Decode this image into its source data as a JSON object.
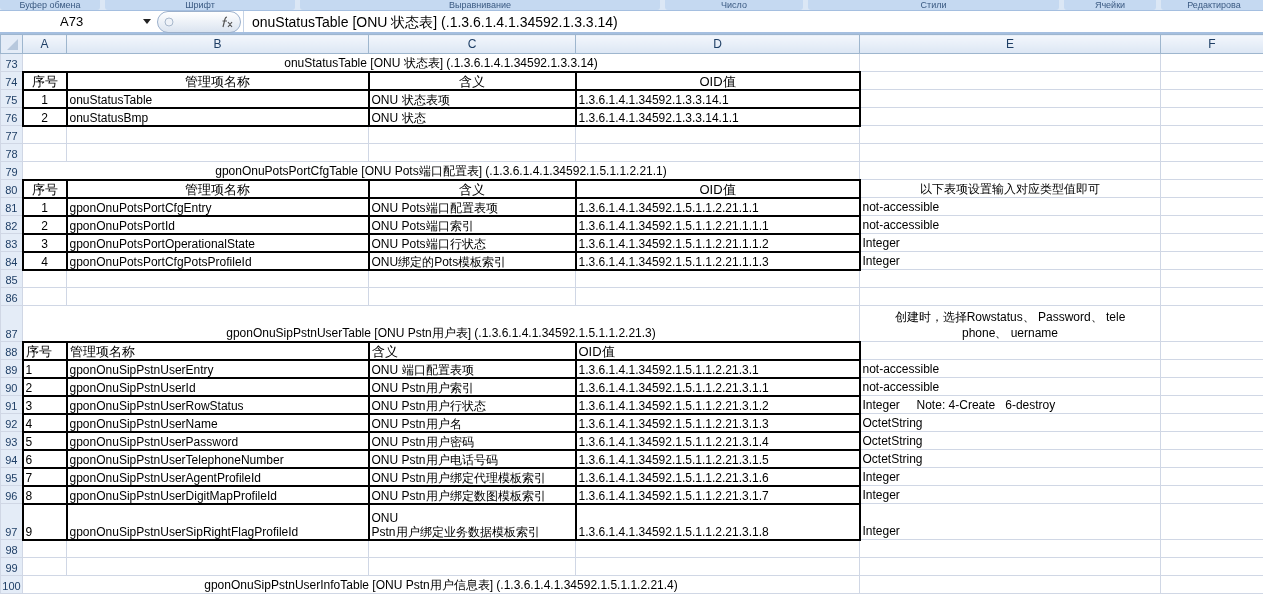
{
  "ribbon_groups": [
    "Буфер обмена",
    "Шрифт",
    "Выравнивание",
    "Число",
    "Стили",
    "Ячейки",
    "Редактирова"
  ],
  "name_box": "A73",
  "formula": "onuStatusTable [ONU 状态表] (.1.3.6.1.4.1.34592.1.3.3.14)",
  "columns": [
    "A",
    "B",
    "C",
    "D",
    "E",
    "F"
  ],
  "rows": [
    {
      "number": "73",
      "kind": "title",
      "tall": false,
      "text": "onuStatusTable [ONU 状态表] (.1.3.6.1.4.1.34592.1.3.3.14)"
    },
    {
      "number": "74",
      "kind": "header",
      "centered": true,
      "cells": [
        "序号",
        "管理项名称",
        "含义",
        "OID值"
      ]
    },
    {
      "number": "75",
      "kind": "data",
      "centered": true,
      "cells": [
        "1",
        "onuStatusTable",
        "ONU 状态表项",
        "1.3.6.1.4.1.34592.1.3.3.14.1"
      ]
    },
    {
      "number": "76",
      "kind": "data",
      "centered": true,
      "cells": [
        "2",
        "onuStatusBmp",
        "ONU 状态",
        "1.3.6.1.4.1.34592.1.3.3.14.1.1"
      ]
    },
    {
      "number": "77",
      "kind": "empty"
    },
    {
      "number": "78",
      "kind": "empty"
    },
    {
      "number": "79",
      "kind": "title",
      "tall": false,
      "text": "gponOnuPotsPortCfgTable [ONU Pots端口配置表] (.1.3.6.1.4.1.34592.1.5.1.1.2.21.1)"
    },
    {
      "number": "80",
      "kind": "header",
      "centered": true,
      "cells": [
        "序号",
        "管理项名称",
        "含义",
        "OID值"
      ],
      "note": "以下表项设置输入对应类型值即可"
    },
    {
      "number": "81",
      "kind": "data",
      "centered": true,
      "cells": [
        "1",
        "gponOnuPotsPortCfgEntry",
        "ONU Pots端口配置表项",
        "1.3.6.1.4.1.34592.1.5.1.1.2.21.1.1"
      ],
      "note": "not-accessible"
    },
    {
      "number": "82",
      "kind": "data",
      "centered": true,
      "cells": [
        "2",
        "gponOnuPotsPortId",
        "ONU Pots端口索引",
        "1.3.6.1.4.1.34592.1.5.1.1.2.21.1.1.1"
      ],
      "note": "not-accessible"
    },
    {
      "number": "83",
      "kind": "data",
      "centered": true,
      "cells": [
        "3",
        "gponOnuPotsPortOperationalState",
        "ONU Pots端口行状态",
        "1.3.6.1.4.1.34592.1.5.1.1.2.21.1.1.2"
      ],
      "note": "Integer"
    },
    {
      "number": "84",
      "kind": "data",
      "centered": true,
      "cells": [
        "4",
        "gponOnuPotsPortCfgPotsProfileId",
        "ONU绑定的Pots模板索引",
        "1.3.6.1.4.1.34592.1.5.1.1.2.21.1.1.3"
      ],
      "note": "Integer"
    },
    {
      "number": "85",
      "kind": "empty"
    },
    {
      "number": "86",
      "kind": "empty"
    },
    {
      "number": "87",
      "kind": "title",
      "tall": true,
      "text": "gponOnuSipPstnUserTable [ONU Pstn用户表] (.1.3.6.1.4.1.34592.1.5.1.1.2.21.3)",
      "note": "创建时，选择Rowstatus、 Password、 tele\nphone、 uername"
    },
    {
      "number": "88",
      "kind": "header",
      "centered": false,
      "cells": [
        "序号",
        "管理项名称",
        "含义",
        "OID值"
      ]
    },
    {
      "number": "89",
      "kind": "data",
      "centered": false,
      "cells": [
        "1",
        "gponOnuSipPstnUserEntry",
        "ONU 端口配置表项",
        "1.3.6.1.4.1.34592.1.5.1.1.2.21.3.1"
      ],
      "note": "not-accessible"
    },
    {
      "number": "90",
      "kind": "data",
      "centered": false,
      "cells": [
        "2",
        "gponOnuSipPstnUserId",
        "ONU Pstn用户索引",
        "1.3.6.1.4.1.34592.1.5.1.1.2.21.3.1.1"
      ],
      "note": "not-accessible"
    },
    {
      "number": "91",
      "kind": "data",
      "centered": false,
      "cells": [
        "3",
        "gponOnuSipPstnUserRowStatus",
        "ONU Pstn用户行状态",
        "1.3.6.1.4.1.34592.1.5.1.1.2.21.3.1.2"
      ],
      "note": "Integer     Note: 4-Create   6-destroy"
    },
    {
      "number": "92",
      "kind": "data",
      "centered": false,
      "cells": [
        "4",
        "gponOnuSipPstnUserName",
        "ONU Pstn用户名",
        "1.3.6.1.4.1.34592.1.5.1.1.2.21.3.1.3"
      ],
      "note": "OctetString"
    },
    {
      "number": "93",
      "kind": "data",
      "centered": false,
      "cells": [
        "5",
        "gponOnuSipPstnUserPassword",
        "ONU Pstn用户密码",
        "1.3.6.1.4.1.34592.1.5.1.1.2.21.3.1.4"
      ],
      "note": "OctetString"
    },
    {
      "number": "94",
      "kind": "data",
      "centered": false,
      "cells": [
        "6",
        "gponOnuSipPstnUserTelephoneNumber",
        "ONU Pstn用户电话号码",
        "1.3.6.1.4.1.34592.1.5.1.1.2.21.3.1.5"
      ],
      "note": "OctetString"
    },
    {
      "number": "95",
      "kind": "data",
      "centered": false,
      "cells": [
        "7",
        "gponOnuSipPstnUserAgentProfileId",
        "ONU Pstn用户绑定代理模板索引",
        "1.3.6.1.4.1.34592.1.5.1.1.2.21.3.1.6"
      ],
      "note": "Integer"
    },
    {
      "number": "96",
      "kind": "data",
      "centered": false,
      "cells": [
        "8",
        "gponOnuSipPstnUserDigitMapProfileId",
        "ONU Pstn用户绑定数图模板索引",
        "1.3.6.1.4.1.34592.1.5.1.1.2.21.3.1.7"
      ],
      "note": "Integer"
    },
    {
      "number": "97",
      "kind": "data",
      "centered": false,
      "tall": true,
      "cells": [
        "9",
        "gponOnuSipPstnUserSipRightFlagProfileId",
        "ONU\nPstn用户绑定业务数据模板索引",
        "1.3.6.1.4.1.34592.1.5.1.1.2.21.3.1.8"
      ],
      "note": "Integer"
    },
    {
      "number": "98",
      "kind": "empty"
    },
    {
      "number": "99",
      "kind": "empty"
    },
    {
      "number": "100",
      "kind": "title",
      "tall": false,
      "text": "gponOnuSipPstnUserInfoTable [ONU Pstn用户信息表] (.1.3.6.1.4.1.34592.1.5.1.1.2.21.4)"
    }
  ]
}
